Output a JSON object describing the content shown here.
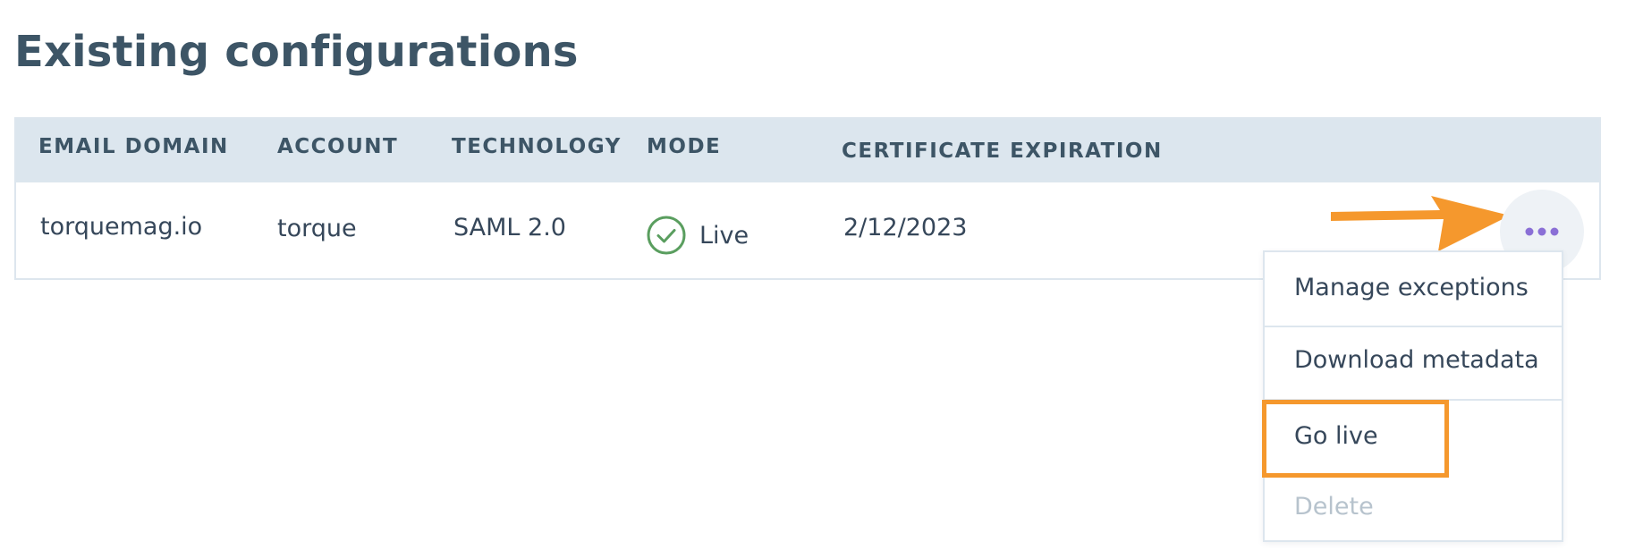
{
  "page": {
    "title": "Existing configurations"
  },
  "table": {
    "columns": [
      "EMAIL DOMAIN",
      "ACCOUNT",
      "TECHNOLOGY",
      "MODE",
      "CERTIFICATE EXPIRATION"
    ],
    "rows": [
      {
        "email_domain": "torquemag.io",
        "account": "torque",
        "technology": "SAML 2.0",
        "mode": "Live",
        "certificate_expiration": "2/12/2023"
      }
    ]
  },
  "row_actions": {
    "more_icon": "more-horizontal-icon",
    "menu_items": [
      {
        "label": "Manage exceptions",
        "enabled": true
      },
      {
        "label": "Download metadata",
        "enabled": true
      },
      {
        "label": "Go live",
        "enabled": true,
        "highlighted": true
      },
      {
        "label": "Delete",
        "enabled": false
      }
    ]
  },
  "icons": {
    "mode_status": "check-circle-icon",
    "annotation_arrow": "arrow-right-icon"
  },
  "colors": {
    "heading": "#3d5566",
    "header_background": "#dce6ee",
    "status_success": "#5a9e5f",
    "more_dots": "#8a6fd6",
    "annotation": "#f5982d",
    "disabled_text": "#b7c3cd"
  }
}
